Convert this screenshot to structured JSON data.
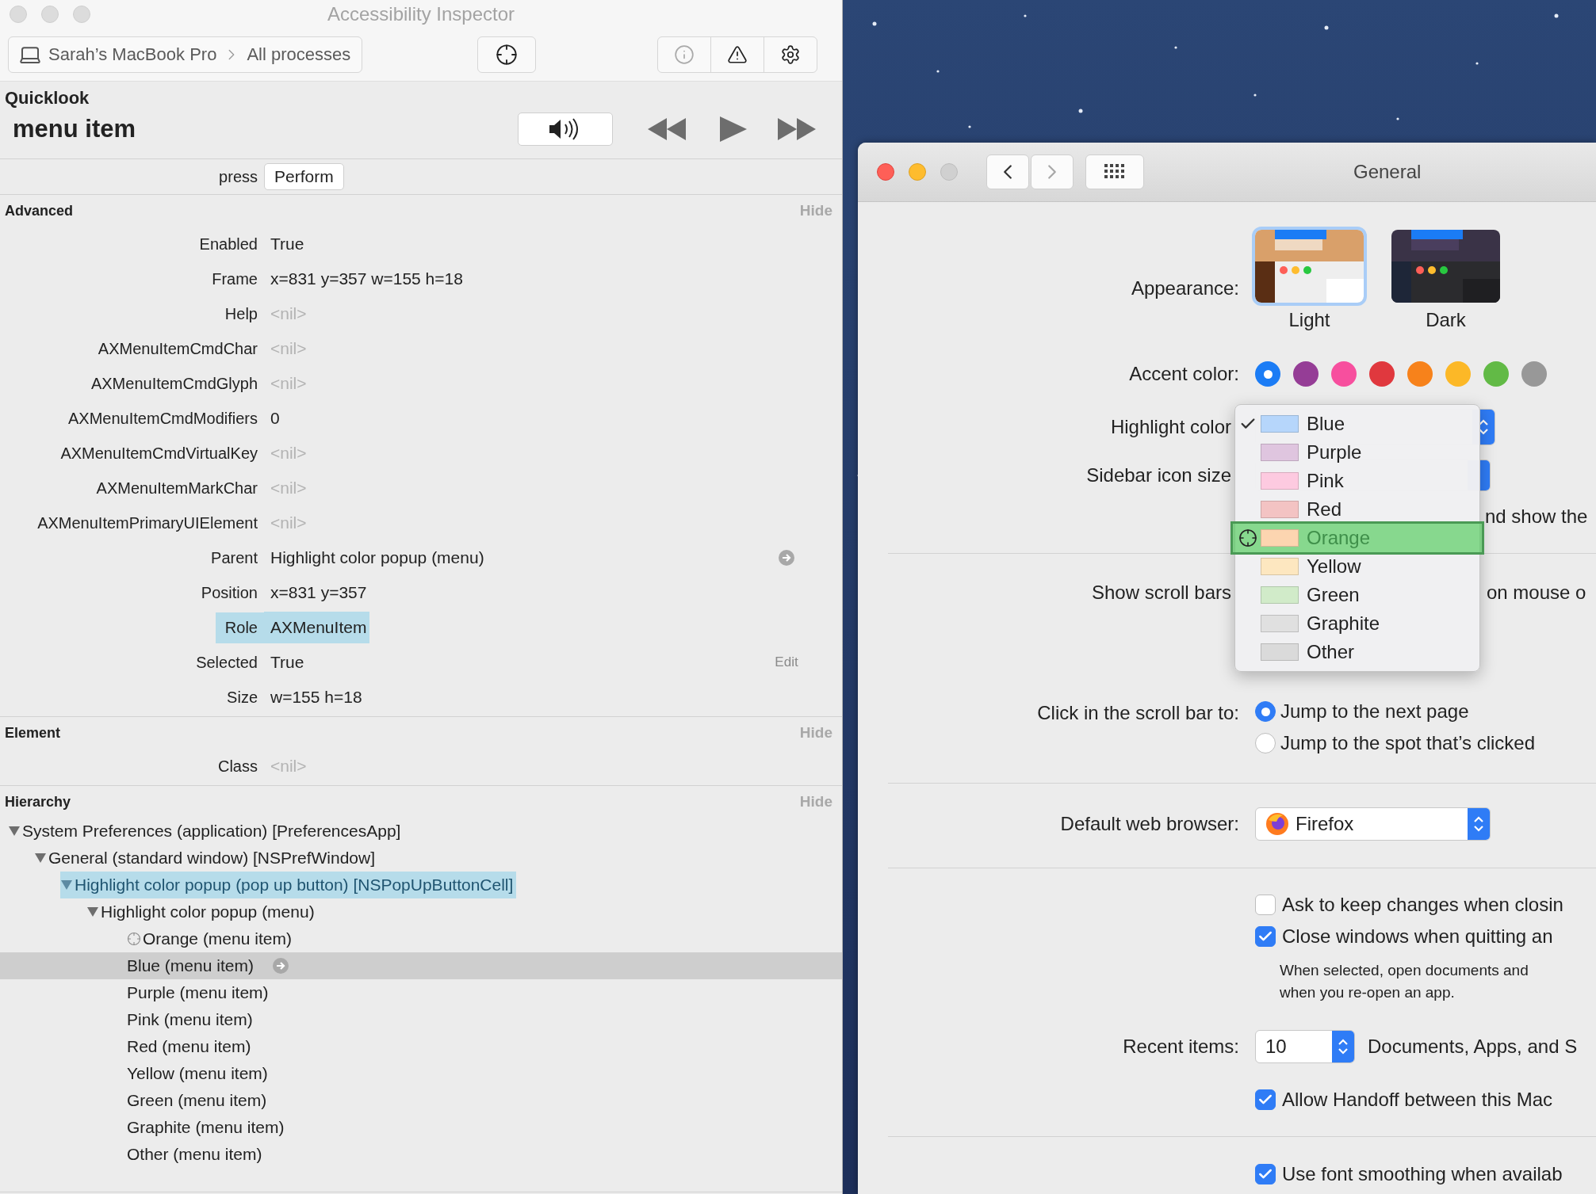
{
  "inspector": {
    "title": "Accessibility Inspector",
    "breadcrumb": [
      "Sarah’s MacBook Pro",
      "All processes"
    ],
    "toolbar_buttons": [
      {
        "kind": "info",
        "disabled": true
      },
      {
        "kind": "warning",
        "disabled": false
      },
      {
        "kind": "settings",
        "disabled": false
      }
    ],
    "quicklook": {
      "heading": "Quicklook",
      "element": "menu item"
    },
    "action": {
      "label": "press",
      "button": "Perform"
    },
    "sections": [
      {
        "title": "Advanced",
        "toggle": "Hide",
        "rows": [
          {
            "label": "Enabled",
            "value": "True",
            "muted": false,
            "highlighted": false,
            "link": false
          },
          {
            "label": "Frame",
            "value": "x=831 y=357 w=155 h=18",
            "muted": false,
            "highlighted": false,
            "link": false
          },
          {
            "label": "Help",
            "value": "<nil>",
            "muted": true,
            "highlighted": false,
            "link": false
          },
          {
            "label": "AXMenuItemCmdChar",
            "value": "<nil>",
            "muted": true,
            "highlighted": false,
            "link": false
          },
          {
            "label": "AXMenuItemCmdGlyph",
            "value": "<nil>",
            "muted": true,
            "highlighted": false,
            "link": false
          },
          {
            "label": "AXMenuItemCmdModifiers",
            "value": "0",
            "muted": false,
            "highlighted": false,
            "link": false
          },
          {
            "label": "AXMenuItemCmdVirtualKey",
            "value": "<nil>",
            "muted": true,
            "highlighted": false,
            "link": false
          },
          {
            "label": "AXMenuItemMarkChar",
            "value": "<nil>",
            "muted": true,
            "highlighted": false,
            "link": false
          },
          {
            "label": "AXMenuItemPrimaryUIElement",
            "value": "<nil>",
            "muted": true,
            "highlighted": false,
            "link": false
          },
          {
            "label": "Parent",
            "value": "Highlight color popup (menu)",
            "muted": false,
            "highlighted": false,
            "link": true
          },
          {
            "label": "Position",
            "value": "x=831 y=357",
            "muted": false,
            "highlighted": false,
            "link": false
          },
          {
            "label": "Role",
            "value": "AXMenuItem",
            "muted": false,
            "highlighted": true,
            "link": false
          },
          {
            "label": "Selected",
            "value": "True",
            "muted": false,
            "highlighted": false,
            "link": false,
            "action": "Edit"
          },
          {
            "label": "Size",
            "value": "w=155 h=18",
            "muted": false,
            "highlighted": false,
            "link": false
          }
        ]
      },
      {
        "title": "Element",
        "toggle": "Hide",
        "rows": [
          {
            "label": "Class",
            "value": "<nil>",
            "muted": true,
            "highlighted": false,
            "link": false
          }
        ]
      }
    ],
    "hierarchy": {
      "title": "Hierarchy",
      "toggle": "Hide",
      "tree": [
        {
          "label": "System Preferences (application) [PreferencesApp]",
          "expanded": true,
          "highlighted": false,
          "selected": false,
          "targeted": false,
          "children": [
            {
              "label": "General (standard window) [NSPrefWindow]",
              "expanded": true,
              "highlighted": false,
              "selected": false,
              "targeted": false,
              "children": [
                {
                  "label": "Highlight color popup (pop up button) [NSPopUpButtonCell]",
                  "expanded": true,
                  "highlighted": true,
                  "selected": false,
                  "targeted": false,
                  "children": [
                    {
                      "label": "Highlight color popup (menu)",
                      "expanded": true,
                      "highlighted": false,
                      "selected": false,
                      "targeted": false,
                      "children": [
                        {
                          "label": "Orange (menu item)",
                          "highlighted": false,
                          "selected": false,
                          "targeted": true
                        },
                        {
                          "label": "Blue (menu item)",
                          "highlighted": false,
                          "selected": true,
                          "targeted": false
                        },
                        {
                          "label": "Purple (menu item)",
                          "highlighted": false,
                          "selected": false,
                          "targeted": false
                        },
                        {
                          "label": "Pink (menu item)",
                          "highlighted": false,
                          "selected": false,
                          "targeted": false
                        },
                        {
                          "label": "Red (menu item)",
                          "highlighted": false,
                          "selected": false,
                          "targeted": false
                        },
                        {
                          "label": "Yellow (menu item)",
                          "highlighted": false,
                          "selected": false,
                          "targeted": false
                        },
                        {
                          "label": "Green (menu item)",
                          "highlighted": false,
                          "selected": false,
                          "targeted": false
                        },
                        {
                          "label": "Graphite (menu item)",
                          "highlighted": false,
                          "selected": false,
                          "targeted": false
                        },
                        {
                          "label": "Other (menu item)",
                          "highlighted": false,
                          "selected": false,
                          "targeted": false
                        }
                      ]
                    }
                  ]
                }
              ]
            }
          ]
        }
      ]
    }
  },
  "preferences": {
    "title": "General",
    "nav": [
      {
        "kind": "back",
        "disabled": false
      },
      {
        "kind": "forward",
        "disabled": true
      }
    ],
    "appearance": {
      "label": "Appearance:",
      "options": [
        {
          "label": "Light",
          "kind": "light",
          "selected": true
        },
        {
          "label": "Dark",
          "kind": "dark",
          "selected": false
        }
      ]
    },
    "accent": {
      "label": "Accent color:",
      "colors": [
        {
          "color": "#1b7cf5",
          "selected": true
        },
        {
          "color": "#953d96",
          "selected": false
        },
        {
          "color": "#f74f9e",
          "selected": false
        },
        {
          "color": "#e0383e",
          "selected": false
        },
        {
          "color": "#f7821b",
          "selected": false
        },
        {
          "color": "#fcb827",
          "selected": false
        },
        {
          "color": "#62ba46",
          "selected": false
        },
        {
          "color": "#989898",
          "selected": false
        }
      ]
    },
    "highlight_label": "Highlight color",
    "sidebar_label": "Sidebar icon size",
    "menu_bar_fragment": "nd show the",
    "scroll_bars": {
      "label": "Show scroll bars",
      "fragment": "on mouse o"
    },
    "click_scroll": {
      "label": "Click in the scroll bar to:",
      "options": [
        {
          "label": "Jump to the next page",
          "selected": true
        },
        {
          "label": "Jump to the spot that’s clicked",
          "selected": false
        }
      ]
    },
    "browser": {
      "label": "Default web browser:",
      "value": "Firefox"
    },
    "window_checks": [
      {
        "label": "Ask to keep changes when closin",
        "checked": false
      },
      {
        "label": "Close windows when quitting an",
        "checked": true
      }
    ],
    "note": "When selected, open documents and\nwhen you re-open an app.",
    "recent": {
      "label": "Recent items:",
      "value": "10",
      "suffix": "Documents, Apps, and S"
    },
    "handoff": {
      "label": "Allow Handoff between this Mac",
      "checked": true
    },
    "smoothing": {
      "label": "Use font smoothing when availab",
      "checked": true
    },
    "menu": [
      {
        "label": "Blue",
        "color": "#b6d6fb",
        "checked": true,
        "highlighted": false
      },
      {
        "label": "Purple",
        "color": "#dfc5df",
        "checked": false,
        "highlighted": false
      },
      {
        "label": "Pink",
        "color": "#fdcae0",
        "checked": false,
        "highlighted": false
      },
      {
        "label": "Red",
        "color": "#f3c3c3",
        "checked": false,
        "highlighted": false
      },
      {
        "label": "Orange",
        "color": "#fcd5b0",
        "checked": false,
        "highlighted": true
      },
      {
        "label": "Yellow",
        "color": "#fde7c0",
        "checked": false,
        "highlighted": false
      },
      {
        "label": "Green",
        "color": "#d1ebc9",
        "checked": false,
        "highlighted": false
      },
      {
        "label": "Graphite",
        "color": "#e0e0e0",
        "checked": false,
        "highlighted": false
      },
      {
        "label": "Other",
        "color": "#dadada",
        "checked": false,
        "highlighted": false
      }
    ]
  }
}
